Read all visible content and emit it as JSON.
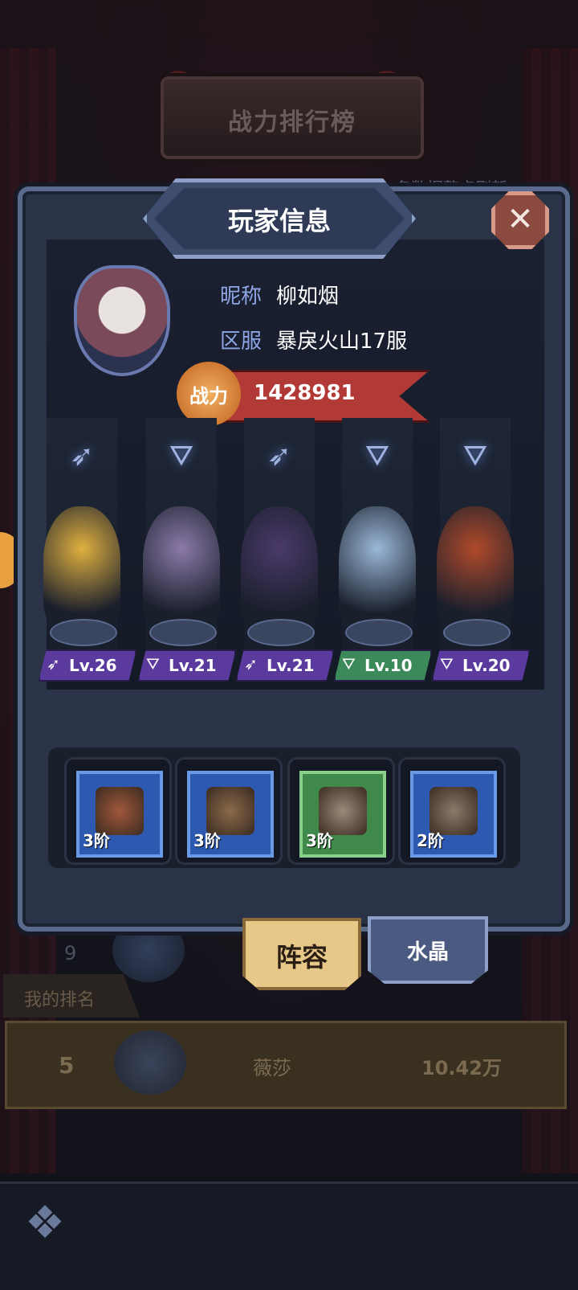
{
  "header": {
    "title": "战力排行榜",
    "refresh_note": "名数据整点刷新"
  },
  "dialog": {
    "title": "玩家信息",
    "close_label": "✕",
    "player": {
      "nickname_label": "昵称",
      "nickname": "柳如烟",
      "server_label": "区服",
      "server": "暴戾火山17服",
      "power_label": "战力",
      "power": "1428981"
    },
    "heroes": [
      {
        "class_icon": "wing-icon",
        "level": "Lv.26",
        "tag_color": "#5a3a9c",
        "figure_color": "#e0b040"
      },
      {
        "class_icon": "hat-icon",
        "level": "Lv.21",
        "tag_color": "#5a3a9c",
        "figure_color": "#8a7aa8"
      },
      {
        "class_icon": "wing-icon",
        "level": "Lv.21",
        "tag_color": "#5a3a9c",
        "figure_color": "#4a3a6a"
      },
      {
        "class_icon": "hat-icon",
        "level": "Lv.10",
        "tag_color": "#3c8a5a",
        "figure_color": "#9ab8d8"
      },
      {
        "class_icon": "hat-icon",
        "level": "Lv.20",
        "tag_color": "#5a3a9c",
        "figure_color": "#b04a2a"
      }
    ],
    "equipment": [
      {
        "icon": "sword-icon",
        "grade": "3阶",
        "rarity": "blue"
      },
      {
        "icon": "pouch-icon",
        "grade": "3阶",
        "rarity": "blue"
      },
      {
        "icon": "pants-icon",
        "grade": "3阶",
        "rarity": "green"
      },
      {
        "icon": "armor-icon",
        "grade": "2阶",
        "rarity": "blue"
      }
    ],
    "tabs": {
      "lineup": "阵容",
      "crystal": "水晶"
    }
  },
  "ranking": {
    "partial_rank": "9",
    "my_rank_label": "我的排名",
    "my_rank": {
      "rank": "5",
      "name": "薇莎",
      "power": "10.42万"
    }
  }
}
